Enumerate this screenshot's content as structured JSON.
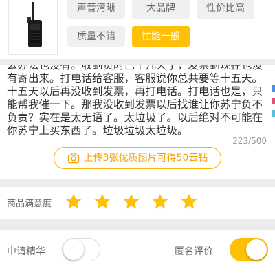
{
  "product": {
    "tags": [
      {
        "label": "声音清晰",
        "selected": false
      },
      {
        "label": "大品牌",
        "selected": false
      },
      {
        "label": "性价比高",
        "selected": false
      },
      {
        "label": "质量不错",
        "selected": false
      },
      {
        "label": "性能一般",
        "selected": true
      }
    ]
  },
  "review": {
    "text": "么办法也没有。收到货时已十几天了，发票到现在也没有寄出来。打电话给客服，客服说你总共要等十五天。十五天以后再没收到发票，再打电话。打电话也是，只能帮我催一下。那我没收到发票以后找谁让你苏宁负不负责？实在是太无语了。太垃圾了。以后绝对不可能在你苏宁上买东西了。垃圾垃圾太垃圾。",
    "count_current": "223",
    "count_max": "/500",
    "upload_label": "上传3张优质图片可得50云钻"
  },
  "rating": {
    "label": "商品满意度",
    "stars": 5,
    "max": 5
  },
  "switches": {
    "essence_label": "申请精华",
    "essence_on": false,
    "anon_label": "匿名评价",
    "anon_on": true
  },
  "colors": {
    "accent": "#ffc107",
    "upload_text": "#f5a300",
    "star": "#ffc107"
  },
  "icons": {
    "camera": "camera-icon",
    "star": "star-icon",
    "product": "walkie-talkie-image"
  }
}
